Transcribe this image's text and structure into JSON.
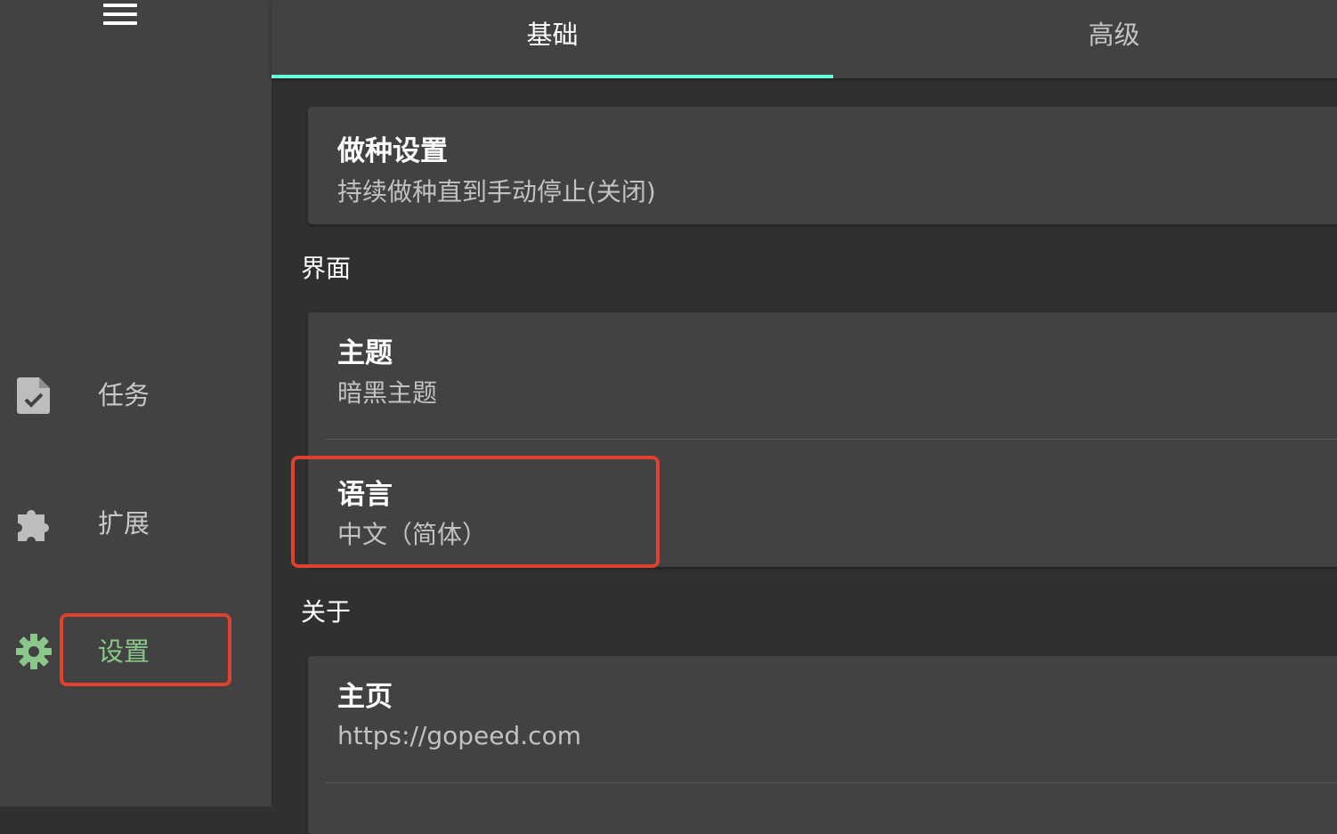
{
  "sidebar": {
    "menu_icon": "hamburger-menu-icon",
    "items": [
      {
        "label": "任务",
        "icon": "task-file-check-icon"
      },
      {
        "label": "扩展",
        "icon": "puzzle-piece-icon"
      },
      {
        "label": "设置",
        "icon": "gear-icon",
        "active": true
      }
    ]
  },
  "tabs": [
    {
      "label": "基础",
      "active": true
    },
    {
      "label": "高级",
      "active": false
    }
  ],
  "seeding": {
    "title": "做种设置",
    "value": "持续做种直到手动停止(关闭)"
  },
  "sections": {
    "interface": "界面",
    "about": "关于"
  },
  "interface_settings": {
    "theme": {
      "title": "主题",
      "value": "暗黑主题"
    },
    "language": {
      "title": "语言",
      "value": "中文（简体）"
    }
  },
  "about_settings": {
    "homepage": {
      "title": "主页",
      "value": "https://gopeed.com"
    }
  },
  "colors": {
    "accent": "#64ffda",
    "active_nav": "#8bc68a",
    "highlight_box": "#e0412f",
    "background": "#303030",
    "surface": "#424242"
  }
}
